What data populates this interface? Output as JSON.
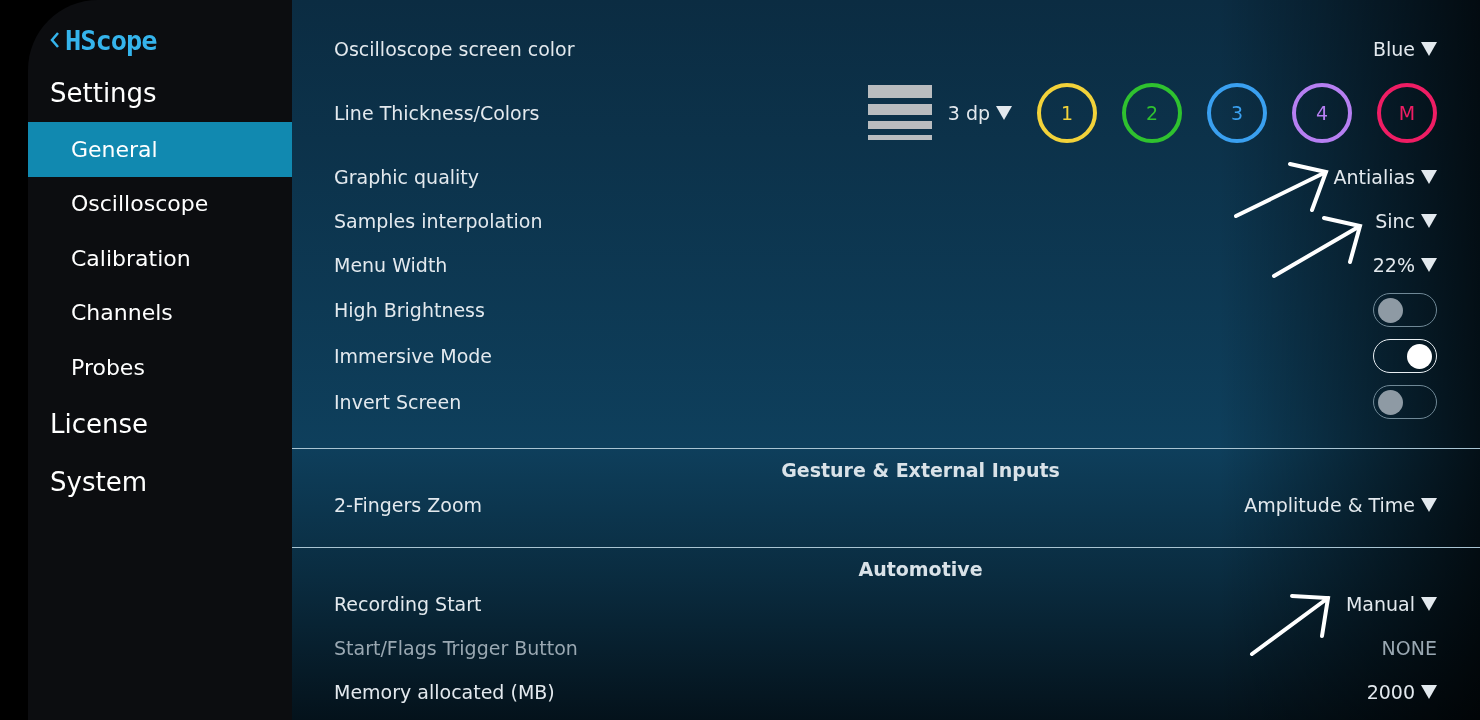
{
  "sidebar": {
    "app_title": "HScope",
    "items": [
      {
        "label": "Settings",
        "selected": false,
        "children": [
          {
            "label": "General",
            "selected": true
          },
          {
            "label": "Oscilloscope",
            "selected": false
          },
          {
            "label": "Calibration",
            "selected": false
          },
          {
            "label": "Channels",
            "selected": false
          },
          {
            "label": "Probes",
            "selected": false
          }
        ]
      },
      {
        "label": "License",
        "selected": false
      },
      {
        "label": "System",
        "selected": false
      }
    ]
  },
  "sections": [
    {
      "rows": [
        {
          "kind": "dropdown",
          "label": "Oscilloscope screen color",
          "value": "Blue",
          "disabled": false
        },
        {
          "kind": "colors",
          "label": "Line Thickness/Colors",
          "thickness": "3 dp",
          "disabled": false,
          "channels": [
            {
              "label": "1",
              "color": "#f2d23a"
            },
            {
              "label": "2",
              "color": "#2fc22f"
            },
            {
              "label": "3",
              "color": "#3aa0f0"
            },
            {
              "label": "4",
              "color": "#b67ff2"
            },
            {
              "label": "M",
              "color": "#ef1d64"
            }
          ]
        },
        {
          "kind": "dropdown",
          "label": "Graphic quality",
          "value": "Antialias",
          "disabled": false
        },
        {
          "kind": "dropdown",
          "label": "Samples interpolation",
          "value": "Sinc",
          "disabled": false
        },
        {
          "kind": "dropdown",
          "label": "Menu Width",
          "value": "22%",
          "disabled": false
        },
        {
          "kind": "toggle",
          "label": "High Brightness",
          "on": false,
          "disabled": false
        },
        {
          "kind": "toggle",
          "label": "Immersive Mode",
          "on": true,
          "disabled": false
        },
        {
          "kind": "toggle",
          "label": "Invert Screen",
          "on": false,
          "disabled": false
        }
      ]
    },
    {
      "title": "Gesture & External Inputs",
      "rows": [
        {
          "kind": "dropdown",
          "label": "2-Fingers Zoom",
          "value": "Amplitude & Time",
          "disabled": false
        }
      ]
    },
    {
      "title": "Automotive",
      "rows": [
        {
          "kind": "dropdown",
          "label": "Recording Start",
          "value": "Manual",
          "disabled": false
        },
        {
          "kind": "text",
          "label": "Start/Flags Trigger Button",
          "value": "NONE",
          "disabled": true
        },
        {
          "kind": "dropdown",
          "label": "Memory allocated (MB)",
          "value": "2000",
          "disabled": false
        }
      ]
    }
  ]
}
